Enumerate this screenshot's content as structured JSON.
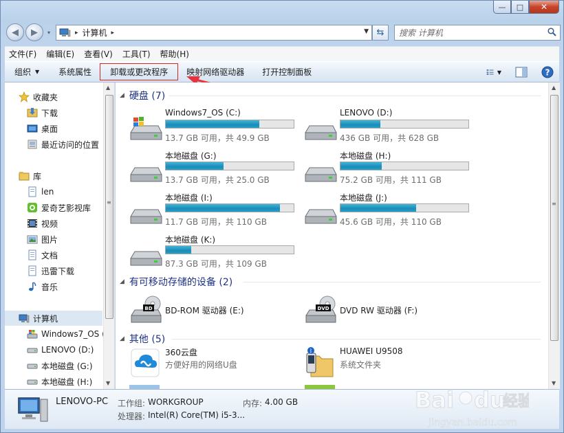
{
  "window": {
    "controls": {
      "minimize": "—",
      "maximize": "□",
      "close": "✕"
    }
  },
  "address": {
    "back": "◀",
    "forward": "▶",
    "separator": "▸",
    "path": "计算机",
    "refresh": "⇆"
  },
  "search": {
    "placeholder": "搜索 计算机"
  },
  "menu": [
    "文件(F)",
    "编辑(E)",
    "查看(V)",
    "工具(T)",
    "帮助(H)"
  ],
  "commands": {
    "organize": "组织",
    "system_properties": "系统属性",
    "uninstall": "卸载或更改程序",
    "map_drive": "映射网络驱动器",
    "control_panel": "打开控制面板"
  },
  "nav": {
    "favorites": {
      "title": "收藏夹",
      "items": [
        "下载",
        "桌面",
        "最近访问的位置"
      ]
    },
    "libraries": {
      "title": "库",
      "items": [
        "len",
        "爱奇艺影视库",
        "视频",
        "图片",
        "文档",
        "迅雷下载",
        "音乐"
      ]
    },
    "computer": {
      "title": "计算机",
      "items": [
        "Windows7_OS (",
        "LENOVO (D:)",
        "本地磁盘 (G:)",
        "本地磁盘 (H:)"
      ]
    }
  },
  "groups": {
    "hdd": "硬盘 (7)",
    "removable": "有可移动存储的设备 (2)",
    "other": "其他 (5)"
  },
  "drives": [
    {
      "name": "Windows7_OS (C:)",
      "free": "13.7 GB 可用，共 49.9 GB",
      "used_fraction": 0.73,
      "icon": "windows-drive-icon"
    },
    {
      "name": "LENOVO (D:)",
      "free": "436 GB 可用，共 628 GB",
      "used_fraction": 0.31,
      "icon": "hard-drive-icon"
    },
    {
      "name": "本地磁盘 (G:)",
      "free": "13.7 GB 可用，共 25.0 GB",
      "used_fraction": 0.45,
      "icon": "hard-drive-icon"
    },
    {
      "name": "本地磁盘 (H:)",
      "free": "75.2 GB 可用，共 111 GB",
      "used_fraction": 0.32,
      "icon": "hard-drive-icon"
    },
    {
      "name": "本地磁盘 (I:)",
      "free": "11.7 GB 可用，共 110 GB",
      "used_fraction": 0.89,
      "icon": "hard-drive-icon"
    },
    {
      "name": "本地磁盘 (J:)",
      "free": "45.6 GB 可用，共 110 GB",
      "used_fraction": 0.59,
      "icon": "hard-drive-icon"
    },
    {
      "name": "本地磁盘 (K:)",
      "free": "87.3 GB 可用，共 109 GB",
      "used_fraction": 0.2,
      "icon": "hard-drive-icon"
    }
  ],
  "removables": [
    {
      "name": "BD-ROM 驱动器 (E:)",
      "badge": "BD"
    },
    {
      "name": "DVD RW 驱动器 (F:)",
      "badge": "DVD"
    }
  ],
  "others": [
    {
      "name": "360云盘",
      "sub": "方便好用的网络U盘",
      "icon": "cloud-icon"
    },
    {
      "name": "HUAWEI U9508",
      "sub": "系统文件夹",
      "icon": "phone-bluetooth-icon"
    }
  ],
  "details": {
    "pc_name": "LENOVO-PC",
    "workgroup_label": "工作组:",
    "workgroup_value": "WORKGROUP",
    "memory_label": "内存:",
    "memory_value": "4.00 GB",
    "processor_label": "处理器:",
    "processor_value": "Intel(R) Core(TM) i5-3..."
  },
  "colors": {
    "accent_header": "#1e3287",
    "bar_fill": "#1a8bb8",
    "highlight_border": "#d9261c"
  }
}
